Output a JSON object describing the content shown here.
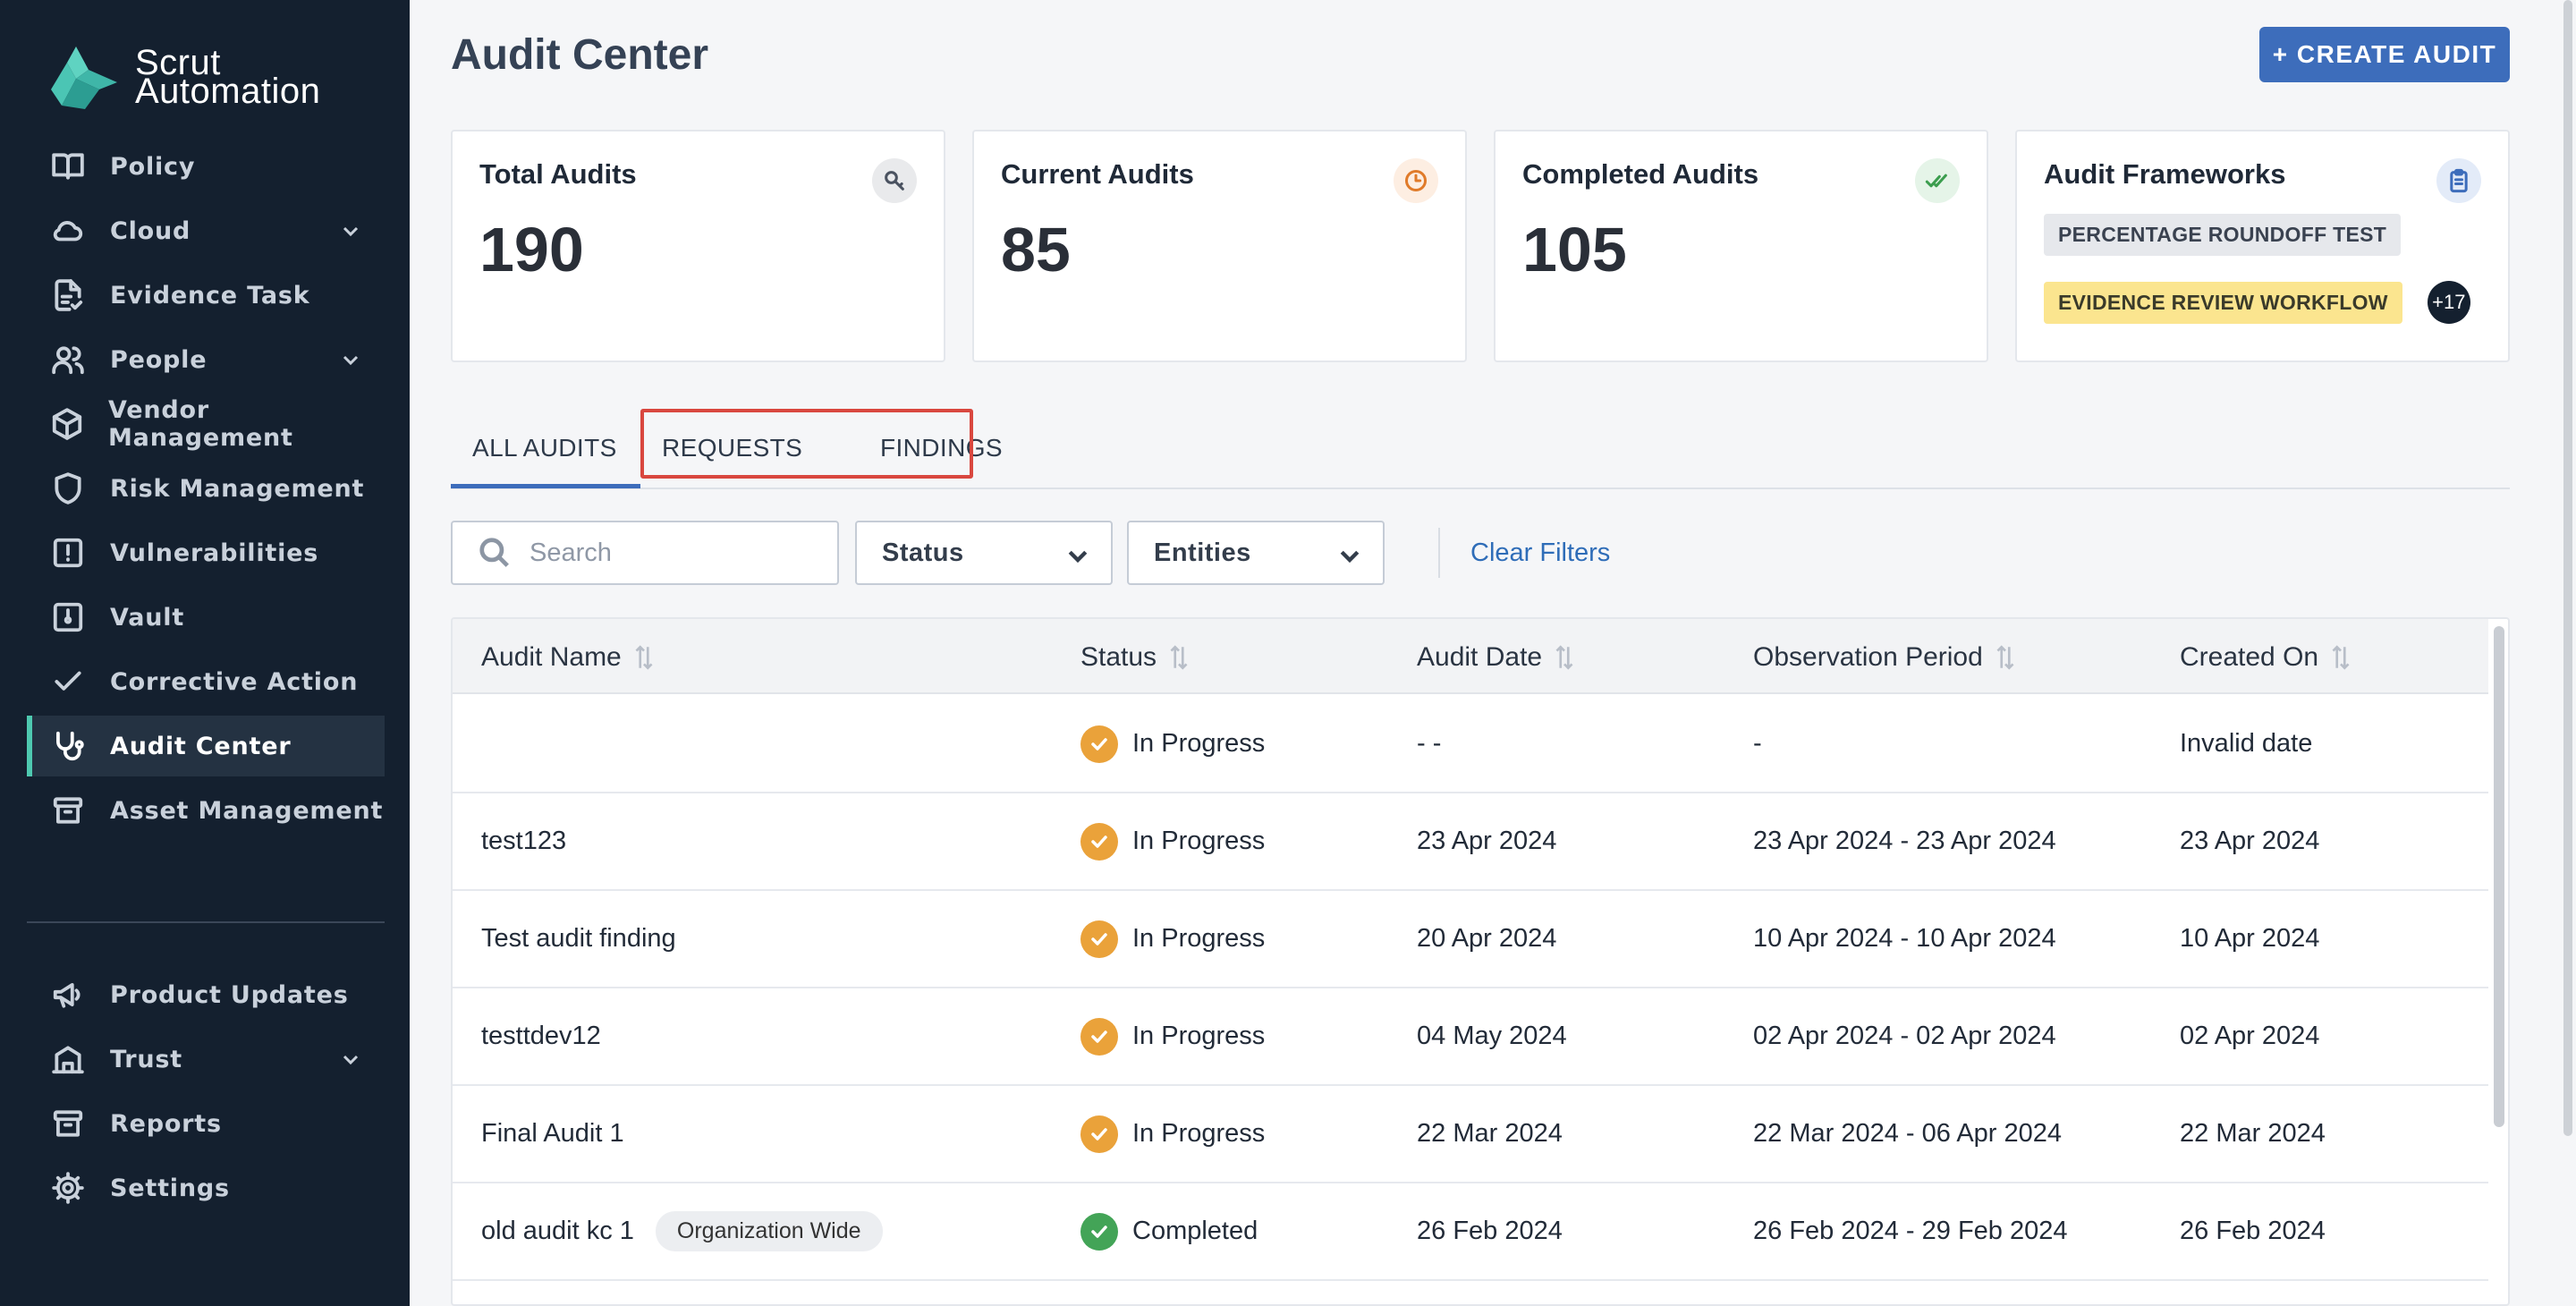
{
  "brand": {
    "line1": "Scrut",
    "line2": "Automation"
  },
  "sidebar": {
    "items": [
      {
        "name": "policy",
        "icon": "book-icon",
        "label": "Policy",
        "expandable": false
      },
      {
        "name": "cloud",
        "icon": "cloud-icon",
        "label": "Cloud",
        "expandable": true
      },
      {
        "name": "evidence-task",
        "icon": "document-check-icon",
        "label": "Evidence Task",
        "expandable": false
      },
      {
        "name": "people",
        "icon": "people-icon",
        "label": "People",
        "expandable": true
      },
      {
        "name": "vendor-management",
        "icon": "cube-icon",
        "label": "Vendor Management",
        "expandable": false
      },
      {
        "name": "risk-management",
        "icon": "shield-icon",
        "label": "Risk Management",
        "expandable": false
      },
      {
        "name": "vulnerabilities",
        "icon": "alert-square-icon",
        "label": "Vulnerabilities",
        "expandable": false
      },
      {
        "name": "vault",
        "icon": "vault-icon",
        "label": "Vault",
        "expandable": false
      },
      {
        "name": "corrective-action",
        "icon": "check-icon",
        "label": "Corrective Action",
        "expandable": false
      },
      {
        "name": "audit-center",
        "icon": "stethoscope-icon",
        "label": "Audit Center",
        "expandable": false
      },
      {
        "name": "asset-management",
        "icon": "archive-icon",
        "label": "Asset Management",
        "expandable": false
      }
    ],
    "secondary": [
      {
        "name": "product-updates",
        "icon": "megaphone-icon",
        "label": "Product Updates",
        "expandable": false
      },
      {
        "name": "trust",
        "icon": "trust-building-icon",
        "label": "Trust",
        "expandable": true
      },
      {
        "name": "reports",
        "icon": "archive-icon",
        "label": "Reports",
        "expandable": false
      },
      {
        "name": "settings",
        "icon": "gear-icon",
        "label": "Settings",
        "expandable": false
      }
    ],
    "active": "Audit Center"
  },
  "header": {
    "title": "Audit Center",
    "create_label": "+ CREATE AUDIT"
  },
  "stats": {
    "total": {
      "title": "Total Audits",
      "value": "190",
      "icon": "key-icon"
    },
    "current": {
      "title": "Current Audits",
      "value": "85",
      "icon": "clock-icon"
    },
    "completed": {
      "title": "Completed Audits",
      "value": "105",
      "icon": "double-check-icon"
    },
    "frameworks": {
      "title": "Audit Frameworks",
      "icon": "clipboard-icon",
      "tags": [
        "PERCENTAGE ROUNDOFF TEST",
        "EVIDENCE REVIEW WORKFLOW"
      ],
      "more": "+17"
    }
  },
  "tabs": [
    "ALL AUDITS",
    "REQUESTS",
    "FINDINGS"
  ],
  "filters": {
    "search_placeholder": "Search",
    "status_label": "Status",
    "entities_label": "Entities",
    "clear_label": "Clear Filters"
  },
  "table": {
    "columns": [
      "Audit Name",
      "Status",
      "Audit Date",
      "Observation Period",
      "Created On"
    ],
    "rows": [
      {
        "name": "",
        "tag": "",
        "status": "In Progress",
        "audit_date": "- -",
        "period": "-",
        "created": "Invalid date"
      },
      {
        "name": "test123",
        "tag": "",
        "status": "In Progress",
        "audit_date": "23 Apr 2024",
        "period": "23 Apr 2024 - 23 Apr 2024",
        "created": "23 Apr 2024"
      },
      {
        "name": "Test audit finding",
        "tag": "",
        "status": "In Progress",
        "audit_date": "20 Apr 2024",
        "period": "10 Apr 2024 - 10 Apr 2024",
        "created": "10 Apr 2024"
      },
      {
        "name": "testtdev12",
        "tag": "",
        "status": "In Progress",
        "audit_date": "04 May 2024",
        "period": "02 Apr 2024 - 02 Apr 2024",
        "created": "02 Apr 2024"
      },
      {
        "name": "Final Audit 1",
        "tag": "",
        "status": "In Progress",
        "audit_date": "22 Mar 2024",
        "period": "22 Mar 2024 - 06 Apr 2024",
        "created": "22 Mar 2024"
      },
      {
        "name": "old audit kc 1",
        "tag": "Organization Wide",
        "status": "Completed",
        "audit_date": "26 Feb 2024",
        "period": "26 Feb 2024 - 29 Feb 2024",
        "created": "26 Feb 2024"
      }
    ]
  },
  "colors": {
    "sidebar_bg": "#14202f",
    "accent": "#3d6dbb",
    "active_marker": "#4ec9b0",
    "in_progress": "#eaa23a",
    "completed": "#43a457",
    "tag_gray": "#e6e8ec",
    "tag_yellow": "#fbe58f",
    "highlight": "#d9473f"
  }
}
